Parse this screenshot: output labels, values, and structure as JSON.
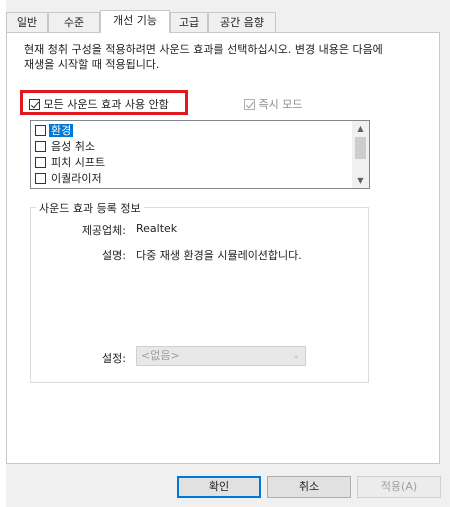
{
  "tabs": [
    {
      "label": "일반"
    },
    {
      "label": "수준"
    },
    {
      "label": "개선 기능"
    },
    {
      "label": "고급"
    },
    {
      "label": "공간 음향"
    }
  ],
  "description": "현재 청취 구성을 적용하려면 사운드 효과를 선택하십시오. 변경 내용은 다음에 재생을 시작할 때 적용됩니다.",
  "disable_all": {
    "label": "모든 사운드 효과 사용 안함",
    "checked": true
  },
  "immediate_mode": {
    "label": "즉시 모드",
    "checked": true,
    "enabled": false
  },
  "effects": [
    {
      "label": "환경",
      "checked": false,
      "selected": true
    },
    {
      "label": "음성 취소",
      "checked": false,
      "selected": false
    },
    {
      "label": "피치 시프트",
      "checked": false,
      "selected": false
    },
    {
      "label": "이퀄라이저",
      "checked": false,
      "selected": false
    }
  ],
  "info_group": {
    "title": "사운드 효과 등록 정보",
    "provider_label": "제공업체:",
    "provider_value": "Realtek",
    "desc_label": "설명:",
    "desc_value": "다중 재생 환경을 시뮬레이션합니다.",
    "setting_label": "설정:",
    "setting_value": "<없음>"
  },
  "buttons": {
    "ok": "확인",
    "cancel": "취소",
    "apply": "적용(A)"
  },
  "colors": {
    "highlight": "#e0191e",
    "selection": "#0078d7",
    "focus_border": "#0078d7"
  }
}
